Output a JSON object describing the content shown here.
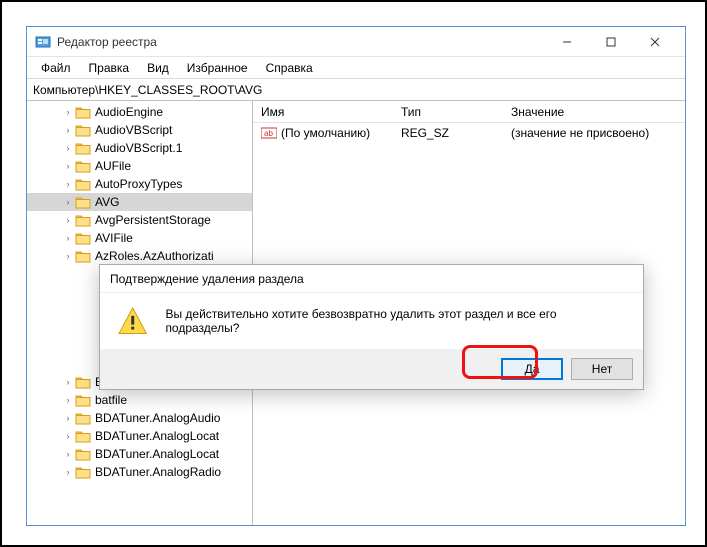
{
  "window": {
    "title": "Редактор реестра"
  },
  "menu": {
    "file": "Файл",
    "edit": "Правка",
    "view": "Вид",
    "favorites": "Избранное",
    "help": "Справка"
  },
  "address": "Компьютер\\HKEY_CLASSES_ROOT\\AVG",
  "tree": {
    "items": [
      {
        "label": "AudioEngine"
      },
      {
        "label": "AudioVBScript"
      },
      {
        "label": "AudioVBScript.1"
      },
      {
        "label": "AUFile"
      },
      {
        "label": "AutoProxyTypes"
      },
      {
        "label": "AVG",
        "selected": true
      },
      {
        "label": "AvgPersistentStorage"
      },
      {
        "label": "AVIFile"
      },
      {
        "label": "AzRoles.AzAuthorizati"
      },
      {
        "label": ""
      },
      {
        "label": ""
      },
      {
        "label": ""
      },
      {
        "label": ""
      },
      {
        "label": ""
      },
      {
        "label": ""
      },
      {
        "label": "BannerNotificationHan"
      },
      {
        "label": "batfile"
      },
      {
        "label": "BDATuner.AnalogAudio"
      },
      {
        "label": "BDATuner.AnalogLocat"
      },
      {
        "label": "BDATuner.AnalogLocat"
      },
      {
        "label": "BDATuner.AnalogRadio"
      }
    ]
  },
  "list": {
    "headers": {
      "name": "Имя",
      "type": "Тип",
      "value": "Значение"
    },
    "row": {
      "name": "(По умолчанию)",
      "type": "REG_SZ",
      "value": "(значение не присвоено)"
    }
  },
  "dialog": {
    "title": "Подтверждение удаления раздела",
    "message": "Вы действительно хотите безвозвратно удалить этот раздел и все его подразделы?",
    "yes": "Да",
    "no": "Нет"
  }
}
